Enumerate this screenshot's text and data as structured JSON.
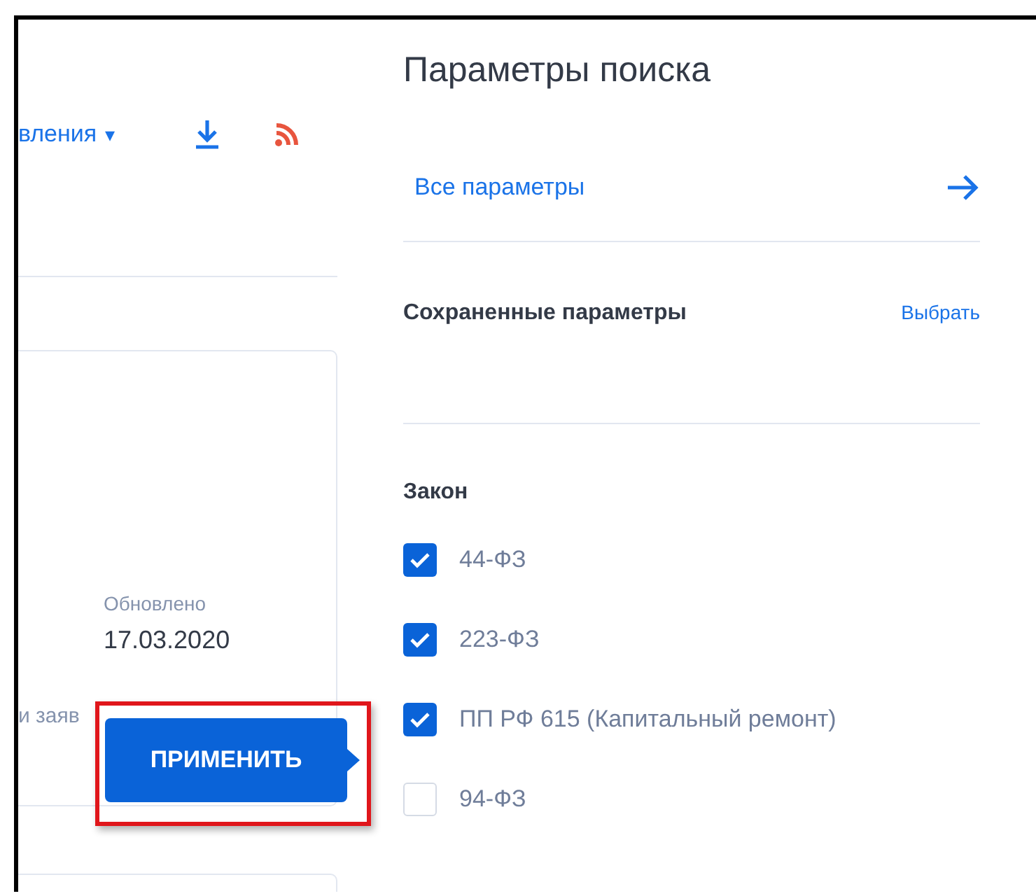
{
  "results_toolbar": {
    "sort_label": "вления",
    "caret": "▾"
  },
  "card": {
    "updated_label": "Обновлено",
    "updated_date": "17.03.2020",
    "footer_text": "и заяв"
  },
  "apply_button": {
    "label": "ПРИМЕНИТЬ"
  },
  "search_panel": {
    "title": "Параметры поиска",
    "all_params_link": "Все параметры",
    "saved_label": "Сохраненные параметры",
    "choose_link": "Выбрать",
    "law_heading": "Закон",
    "laws": [
      {
        "label": "44-ФЗ",
        "checked": true
      },
      {
        "label": "223-ФЗ",
        "checked": true
      },
      {
        "label": "ПП РФ 615 (Капитальный ремонт)",
        "checked": true
      },
      {
        "label": "94-ФЗ",
        "checked": false
      }
    ]
  }
}
